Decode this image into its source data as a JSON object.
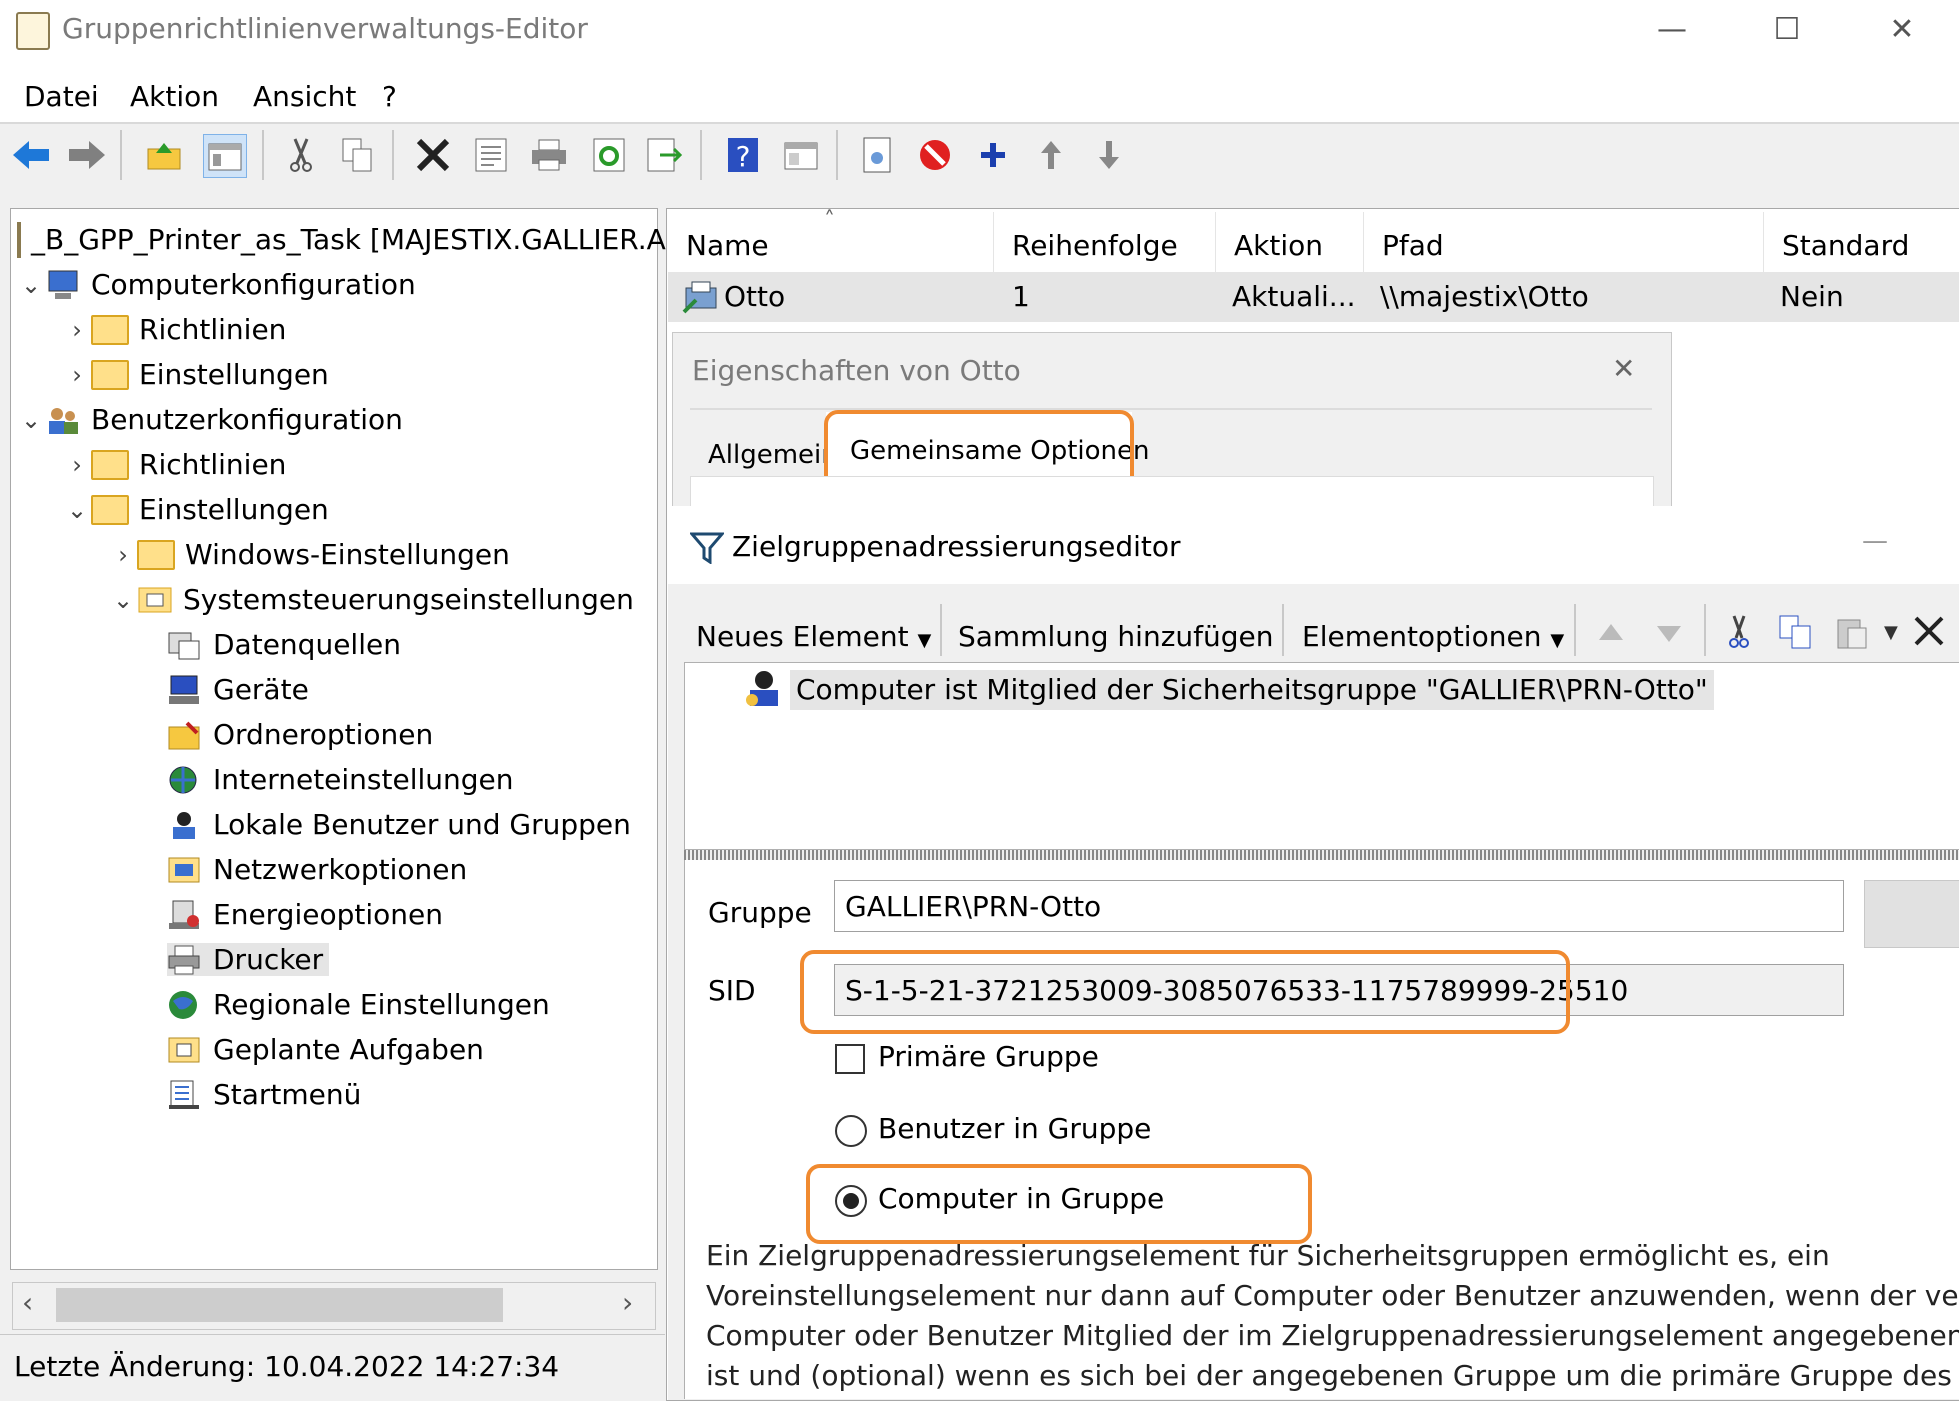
{
  "window": {
    "title": "Gruppenrichtlinienverwaltungs-Editor",
    "controls": {
      "minimize": "—",
      "maximize": "☐",
      "close": "✕"
    }
  },
  "menu": [
    "Datei",
    "Aktion",
    "Ansicht",
    "?"
  ],
  "tree": {
    "root": "_B_GPP_Printer_as_Task [MAJESTIX.GALLIER.AD",
    "computer": "Computerkonfiguration",
    "c_policies": "Richtlinien",
    "c_prefs": "Einstellungen",
    "user": "Benutzerkonfiguration",
    "u_policies": "Richtlinien",
    "u_prefs": "Einstellungen",
    "win_settings": "Windows-Einstellungen",
    "cp_settings": "Systemsteuerungseinstellungen",
    "cp_items": [
      "Datenquellen",
      "Geräte",
      "Ordneroptionen",
      "Interneteinstellungen",
      "Lokale Benutzer und Gruppen",
      "Netzwerkoptionen",
      "Energieoptionen",
      "Drucker",
      "Regionale Einstellungen",
      "Geplante Aufgaben",
      "Startmenü"
    ],
    "selected": "Drucker"
  },
  "status": "Letzte Änderung: 10.04.2022 14:27:34",
  "list": {
    "columns": [
      "Name",
      "Reihenfolge",
      "Aktion",
      "Pfad",
      "Standard"
    ],
    "sort_indicator": "˄",
    "rows": [
      {
        "name": "Otto",
        "order": "1",
        "action": "Aktuali...",
        "path": "\\\\majestix\\Otto",
        "default": "Nein"
      }
    ]
  },
  "props_dialog": {
    "title": "Eigenschaften von Otto",
    "close": "✕",
    "tabs": [
      "Allgemein",
      "Gemeinsame Optionen"
    ]
  },
  "editor": {
    "title": "Zielgruppenadressierungseditor",
    "minimize": "—",
    "toolbar": {
      "new_item": "Neues Element",
      "add_collection": "Sammlung hinzufügen",
      "item_options": "Elementoptionen"
    },
    "item": "Computer ist Mitglied der Sicherheitsgruppe \"GALLIER\\PRN-Otto\"",
    "group_label": "Gruppe",
    "group_value": "GALLIER\\PRN-Otto",
    "sid_label": "SID",
    "sid_value": "S-1-5-21-3721253009-3085076533-1175789999-25510",
    "primary_group": "Primäre Gruppe",
    "primary_checked": false,
    "user_in_group": "Benutzer in Gruppe",
    "computer_in_group": "Computer in Gruppe",
    "selected_option": "Computer in Gruppe",
    "description": [
      "Ein Zielgruppenadressierungselement für Sicherheitsgruppen ermöglicht es, ein",
      "Voreinstellungselement nur dann auf Computer oder Benutzer anzuwenden, wenn der verarbe",
      "Computer oder Benutzer Mitglied der im Zielgruppenadressierungselement angegebenen Gru",
      "ist und (optional) wenn es sich bei der angegebenen Gruppe um die primäre Gruppe des"
    ]
  },
  "colors": {
    "highlight": "#f08a30",
    "selection": "#e5e5e5"
  }
}
